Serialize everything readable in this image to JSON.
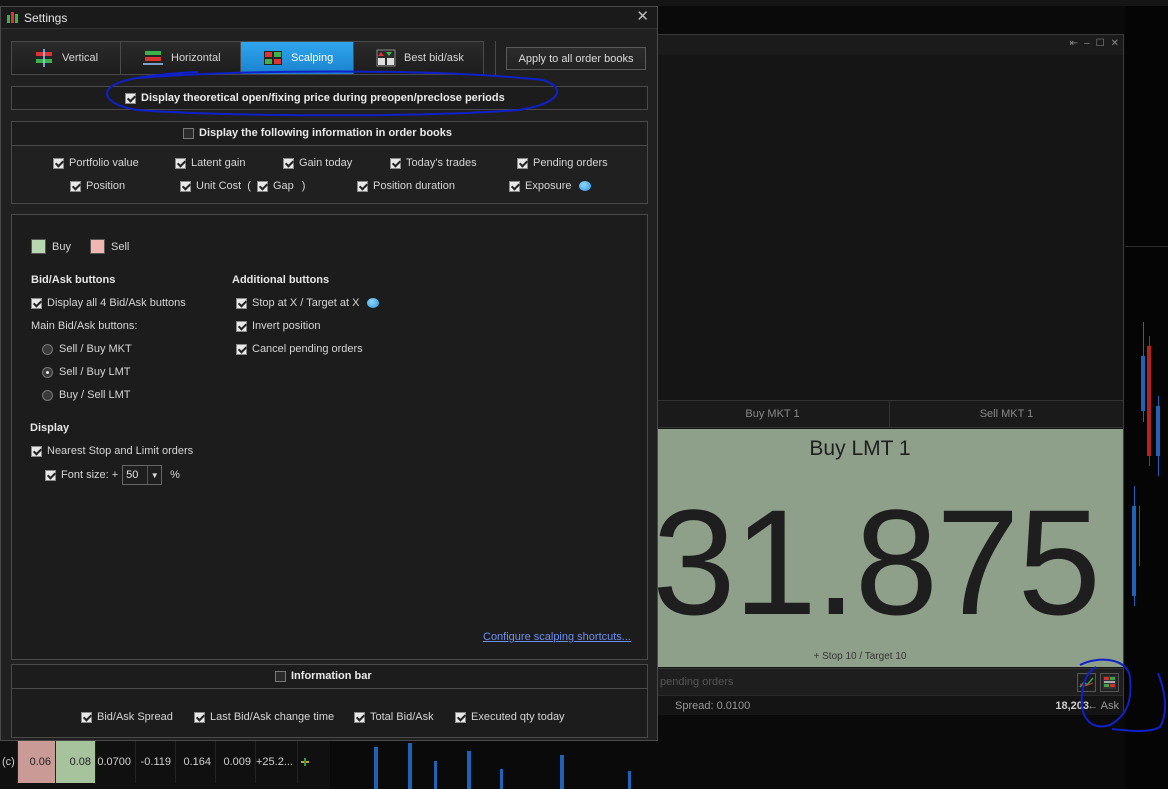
{
  "settings": {
    "title": "Settings",
    "close_glyph": "✕",
    "tabs": [
      {
        "label": "Vertical",
        "icon": "vertical-layout-icon",
        "active": false
      },
      {
        "label": "Horizontal",
        "icon": "horizontal-layout-icon",
        "active": false
      },
      {
        "label": "Scalping",
        "icon": "scalping-grid-icon",
        "active": true
      },
      {
        "label": "Best bid/ask",
        "icon": "best-bid-ask-icon",
        "active": false
      }
    ],
    "apply_all": "Apply to all order books",
    "theoretical": {
      "label": "Display theoretical open/fixing price during preopen/preclose periods",
      "checked": true
    },
    "info": {
      "header": {
        "label": "Display the following information in order books",
        "checked": false
      },
      "portfolio_value": "Portfolio value",
      "latent_gain": "Latent gain",
      "gain_today": "Gain today",
      "todays_trades": "Today's trades",
      "pending_orders": "Pending orders",
      "position": "Position",
      "unit_cost": "Unit Cost",
      "open_paren": "(",
      "gap": "Gap",
      "close_paren": ")",
      "position_duration": "Position duration",
      "exposure": "Exposure"
    },
    "scalping": {
      "buy": "Buy",
      "sell": "Sell",
      "buy_color": "#b9d6b1",
      "sell_color": "#f0b6b2",
      "bidask_title": "Bid/Ask buttons",
      "display_all": "Display all 4 Bid/Ask buttons",
      "main_buttons": "Main Bid/Ask buttons:",
      "radio_1": "Sell / Buy MKT",
      "radio_2": "Sell / Buy LMT",
      "radio_3": "Buy / Sell LMT",
      "additional_title": "Additional buttons",
      "stop_target": "Stop at X / Target at X",
      "invert": "Invert position",
      "cancel_pending": "Cancel pending orders",
      "display_title": "Display",
      "nearest": "Nearest Stop and Limit orders",
      "font_size": "Font size: +",
      "font_value": "50",
      "percent": "%",
      "configure_link": "Configure scalping shortcuts..."
    },
    "info_bar": {
      "header": "Information bar",
      "spread": "Bid/Ask Spread",
      "last_change": "Last Bid/Ask change time",
      "total": "Total Bid/Ask",
      "executed": "Executed qty today"
    }
  },
  "orderbook": {
    "controls": [
      "⇤",
      "–",
      "☐",
      "✕"
    ],
    "buy_mkt": "Buy MKT 1",
    "sell_mkt": "Sell MKT 1",
    "big_title": "Buy LMT 1",
    "big_price": "31.875",
    "big_sub": "+ Stop 10 / Target 10",
    "pending_placeholder": "pending orders",
    "spread": "Spread:  0.0100",
    "ask_value": "18,203",
    "ask_label": "← Ask"
  },
  "table_row": {
    "c0": "(c)",
    "c1": "0.06",
    "c2": "0.08",
    "c3": "0.0700",
    "c4": "-0.119",
    "c5": "0.164",
    "c6": "0.009",
    "c7": "+25.2..."
  }
}
